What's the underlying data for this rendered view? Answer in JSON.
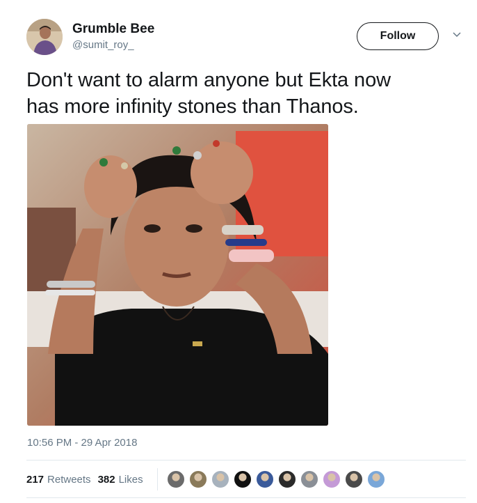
{
  "user": {
    "display_name": "Grumble Bee",
    "handle": "@sumit_roy_"
  },
  "follow_label": "Follow",
  "tweet": {
    "line1": "Don't want to alarm anyone but Ekta now",
    "line2": "has more infinity stones than Thanos.",
    "timestamp": "10:56 PM - 29 Apr 2018"
  },
  "stats": {
    "retweets_count": "217",
    "retweets_label": "Retweets",
    "likes_count": "382",
    "likes_label": "Likes"
  },
  "likers": [
    {
      "color": "#6b6b6b"
    },
    {
      "color": "#8a7a5a"
    },
    {
      "color": "#a7b2bd"
    },
    {
      "color": "#111111"
    },
    {
      "color": "#3a5a9a"
    },
    {
      "color": "#2b2b2b"
    },
    {
      "color": "#8a8f96"
    },
    {
      "color": "#c49ad6"
    },
    {
      "color": "#4a4a4a"
    },
    {
      "color": "#7aa7d8"
    }
  ],
  "colors": {
    "text": "#14171a",
    "secondary": "#657786",
    "divider": "#e1e8ed"
  }
}
